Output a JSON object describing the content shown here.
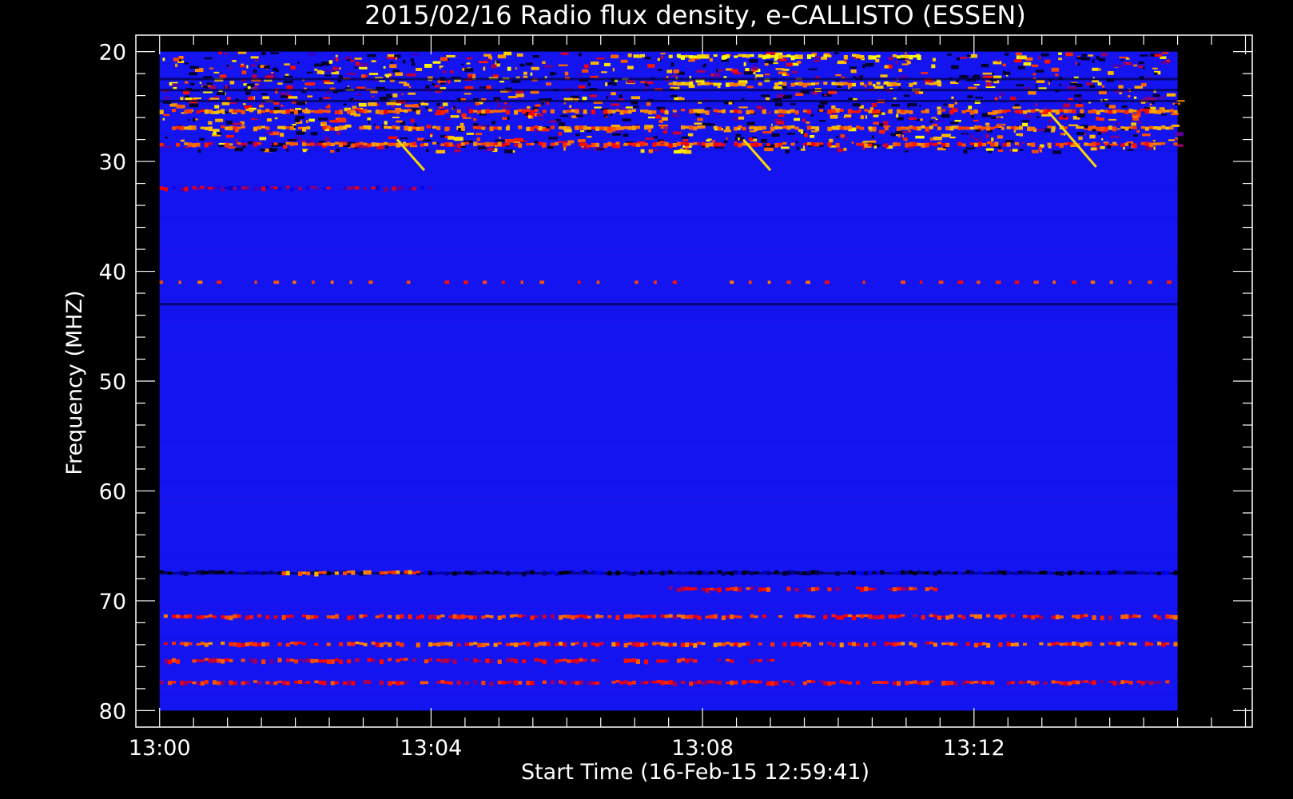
{
  "chart_data": {
    "type": "heatmap",
    "title": "2015/02/16  Radio flux density, e-CALLISTO (ESSEN)",
    "xlabel": "Start Time (16-Feb-15 12:59:41)",
    "ylabel": "Frequency (MHZ)",
    "x_ticks": [
      "13:00",
      "13:04",
      "13:08",
      "13:12"
    ],
    "x_tick_minutes": [
      0,
      4,
      8,
      12
    ],
    "x_range_minutes": [
      -0.35,
      16.1
    ],
    "data_range_minutes": [
      0,
      15
    ],
    "y_ticks": [
      "20",
      "30",
      "40",
      "50",
      "60",
      "70",
      "80"
    ],
    "y_tick_values": [
      20,
      30,
      40,
      50,
      60,
      70,
      80
    ],
    "ylim": [
      18.5,
      81.5
    ],
    "y_inverted": true,
    "colormap": [
      "#000000",
      "#0000ff",
      "#ff0000",
      "#ffa000",
      "#ffff00"
    ],
    "background_color": "#1414f0",
    "bright_bands_mhz": [
      {
        "freq": 20.5,
        "from": 7.5,
        "to": 11.2,
        "level": 0.95
      },
      {
        "freq": 23.0,
        "from": 7.5,
        "to": 11.5,
        "level": 0.8
      },
      {
        "freq": 25.5,
        "from": 0.0,
        "to": 15.0,
        "level": 0.65
      },
      {
        "freq": 27.0,
        "from": 0.0,
        "to": 15.0,
        "level": 0.7
      },
      {
        "freq": 28.5,
        "from": 0.0,
        "to": 15.0,
        "level": 0.6
      },
      {
        "freq": 32.5,
        "from": 0.0,
        "to": 4.0,
        "level": 0.35
      },
      {
        "freq": 41.0,
        "from": 0.0,
        "to": 15.0,
        "level": 0.6,
        "dashed": true
      },
      {
        "freq": 67.5,
        "from": 0.0,
        "to": 15.0,
        "level": 0.1
      },
      {
        "freq": 67.5,
        "from": 1.8,
        "to": 3.8,
        "level": 0.7
      },
      {
        "freq": 69.0,
        "from": 7.5,
        "to": 11.5,
        "level": 0.5
      },
      {
        "freq": 71.5,
        "from": 0.0,
        "to": 15.0,
        "level": 0.55
      },
      {
        "freq": 74.0,
        "from": 0.0,
        "to": 15.0,
        "level": 0.6
      },
      {
        "freq": 75.5,
        "from": 0.0,
        "to": 9.0,
        "level": 0.5
      },
      {
        "freq": 77.5,
        "from": 0.0,
        "to": 15.0,
        "level": 0.5
      }
    ],
    "burst_streaks": [
      {
        "t0": 3.5,
        "f0": 28.0,
        "t1": 3.9,
        "f1": 30.8
      },
      {
        "t0": 8.6,
        "f0": 28.0,
        "t1": 9.0,
        "f1": 30.8
      },
      {
        "t0": 13.1,
        "f0": 25.5,
        "t1": 13.8,
        "f1": 30.5
      }
    ],
    "dark_bands_mhz": [
      22.5,
      23.5,
      24.5,
      43.0,
      67.5
    ]
  }
}
